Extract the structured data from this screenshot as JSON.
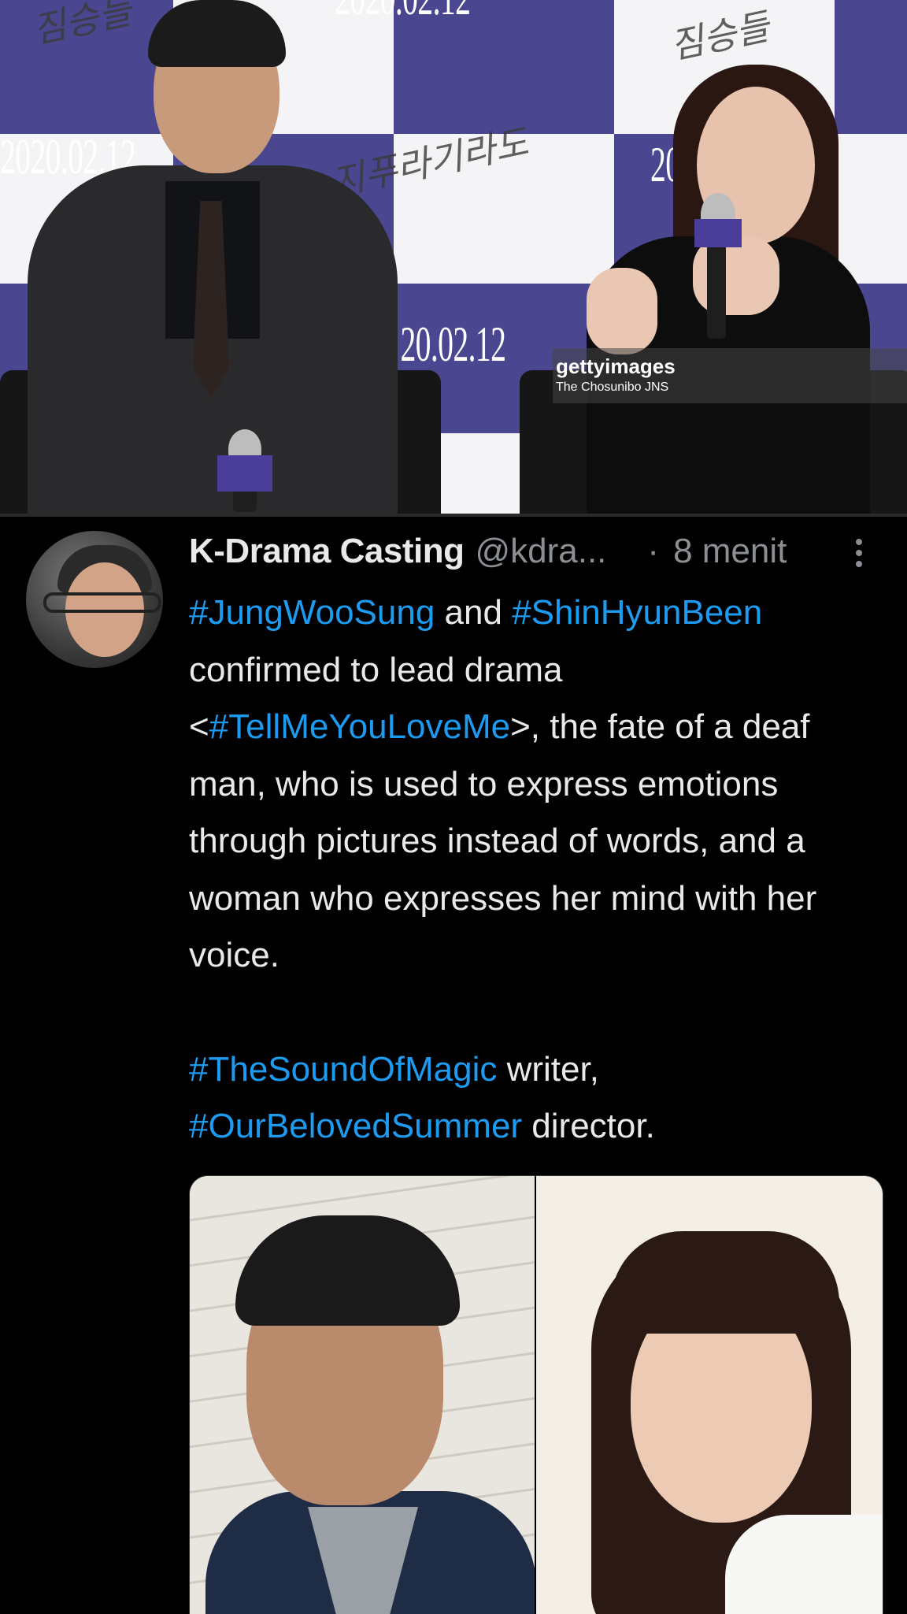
{
  "press_photo": {
    "wall_date_texts": [
      "2020.02.12",
      "2020.02.12",
      "2020.02.12",
      "2020.02.12"
    ],
    "watermark_logo": "gettyimages",
    "watermark_credit": "The Chosunibo JNS",
    "colors": {
      "backdrop_purple": "#4a4690",
      "backdrop_white": "#f4f4f7"
    }
  },
  "tweet": {
    "author_name": "K-Drama Casting",
    "author_handle": "@kdra...",
    "separator": "·",
    "time": "8 menit",
    "text": {
      "tag1": "#JungWooSung",
      "and": " and ",
      "tag2": "#ShinHyunBeen",
      "line_a": " confirmed to lead drama <",
      "tag3": "#TellMeYouLoveMe",
      "line_b": ">, the fate of a deaf man, who is used to express emotions through pictures instead of words, and a woman who expresses her mind with her voice.",
      "tag4": "#TheSoundOfMagic",
      "writer": " writer,",
      "tag5": "#OurBelovedSummer",
      "director": " director."
    }
  },
  "colors": {
    "background": "#000000",
    "text": "#e7e9ea",
    "muted": "#8b8f94",
    "link": "#1d9bf0"
  }
}
